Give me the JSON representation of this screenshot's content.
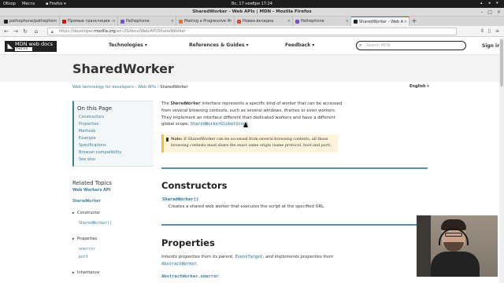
{
  "system_bar": {
    "activities": "Обзор",
    "places": "Места",
    "app": "Firefox",
    "clock": "Вс, 17 ноября  17:24"
  },
  "window": {
    "title": "SharedWorker - Web APIs | MDN - Mozilla Firefox"
  },
  "tabs": [
    {
      "label": "pathephone/pathephone",
      "favicon_color": "#222222"
    },
    {
      "label": "Прямые трансляции - Yo",
      "favicon_color": "#ff0000"
    },
    {
      "label": "Pathephone",
      "favicon_color": "#7a4fd1"
    },
    {
      "label": "Making a Progressive W",
      "favicon_color": "#e8742c"
    },
    {
      "label": "Новая вкладка",
      "favicon_color": "#e04b2a"
    },
    {
      "label": "Pathephone",
      "favicon_color": "#7a4fd1"
    },
    {
      "label": "SharedWorker - Web A",
      "favicon_color": "#222222",
      "active": true
    }
  ],
  "urlbar": {
    "prefix": "https://developer.",
    "domain": "mozilla.org",
    "path": "/en-US/docs/Web/API/SharedWorker"
  },
  "mdn": {
    "logo_text": "MDN web docs",
    "logo_sub": "moz://a",
    "nav": [
      "Technologies ▾",
      "References & Guides ▾",
      "Feedback ▾"
    ],
    "search_placeholder": "Search MDN",
    "signin": "Sign in"
  },
  "page": {
    "title": "SharedWorker",
    "breadcrumb": [
      "Web technology for developers",
      "Web APIs",
      "SharedWorker"
    ],
    "language": "English ▾",
    "intro_pre": "The ",
    "intro_name": "SharedWorker",
    "intro_post": " interface represents a specific kind of worker that can be accessed from several browsing contexts, such as several windows, iframes or even workers. They implement an interface different than dedicated workers and have a different global scope, ",
    "intro_link": "SharedWorkerGlobalScope",
    "intro_end": ".",
    "note_label": "Note:",
    "note_text": " If SharedWorker can be accessed from several browsing contexts, all those browsing contexts must share the exact same origin (same protocol, host and port).",
    "constructors_heading": "Constructors",
    "constructor_name": "SharedWorker()",
    "constructor_desc": "Creates a shared web worker that executes the script at the specified URL.",
    "properties_heading": "Properties",
    "inherits_pre": "Inherits properties from its parent, ",
    "inherits_link1": "EventTarget",
    "inherits_mid": ", and implements properties from ",
    "inherits_link2": "AbstractWorker",
    "inherits_end": ".",
    "property_first": "AbstractWorker.onerror"
  },
  "toc": {
    "title": "On this Page",
    "items": [
      "Constructors",
      "Properties",
      "Methods",
      "Example",
      "Specifications",
      "Browser compatibility",
      "See also"
    ]
  },
  "related": {
    "title": "Related Topics",
    "sub": "Web Workers API",
    "iface": "SharedWorker",
    "groups": [
      "Constructor",
      "Properties",
      "Inheritance"
    ],
    "constructor_items": [
      "SharedWorker()"
    ],
    "property_items": [
      "onerror",
      "port"
    ]
  }
}
